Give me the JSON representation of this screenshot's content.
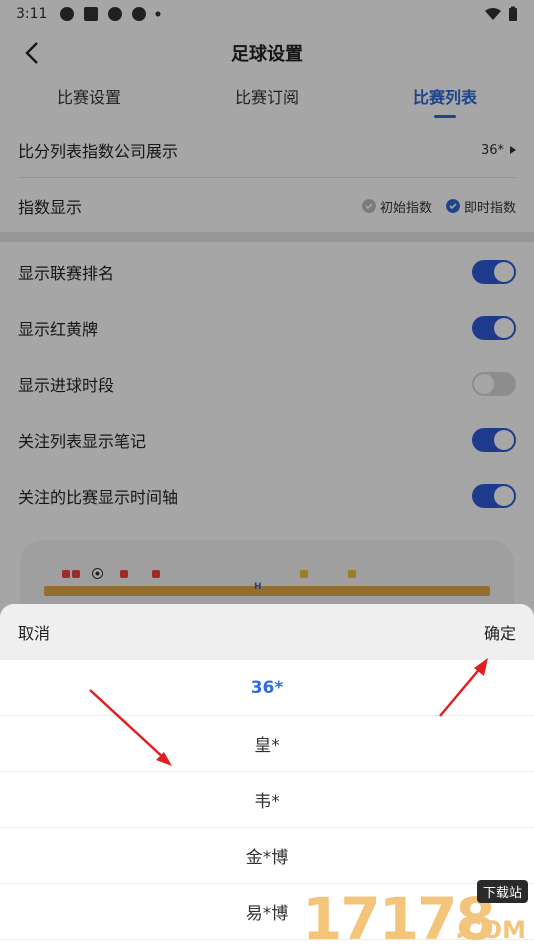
{
  "status": {
    "time": "3:11"
  },
  "header": {
    "title": "足球设置"
  },
  "tabs": [
    {
      "label": "比赛设置"
    },
    {
      "label": "比赛订阅"
    },
    {
      "label": "比赛列表",
      "active": true
    }
  ],
  "rows": {
    "company": {
      "label": "比分列表指数公司展示",
      "value": "36*"
    },
    "index_display": {
      "label": "指数显示",
      "options": [
        "初始指数",
        "即时指数"
      ]
    },
    "toggles": [
      {
        "label": "显示联赛排名",
        "on": true
      },
      {
        "label": "显示红黄牌",
        "on": true
      },
      {
        "label": "显示进球时段",
        "on": false
      },
      {
        "label": "关注列表显示笔记",
        "on": true
      },
      {
        "label": "关注的比赛显示时间轴",
        "on": true
      }
    ]
  },
  "preview": {
    "half_marker": "H"
  },
  "sheet": {
    "cancel": "取消",
    "confirm": "确定",
    "options": [
      "36*",
      "皇*",
      "韦*",
      "金*博",
      "易*博"
    ],
    "selected_index": 0
  },
  "watermark": {
    "digits": "17178",
    "tag": "下载站",
    "com": ".COM"
  },
  "colors": {
    "accent": "#2f6bd8",
    "toggle_on": "#2e5bd6",
    "arrow": "#e02020",
    "watermark": "#f2c57a"
  }
}
